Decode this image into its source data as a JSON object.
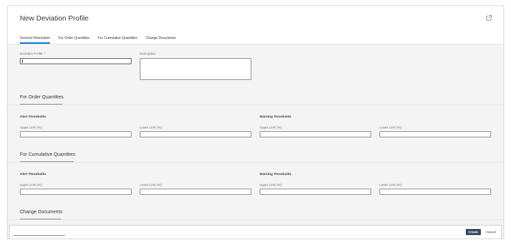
{
  "header": {
    "title": "New Deviation Profile",
    "tabs": [
      {
        "label": "General Information",
        "active": true
      },
      {
        "label": "For Order Quantities",
        "active": false
      },
      {
        "label": "For Cumulative Quantities",
        "active": false
      },
      {
        "label": "Change Documents",
        "active": false
      }
    ]
  },
  "general": {
    "profile_label": "Deviation Profile *",
    "description_label": "Description"
  },
  "order_section": {
    "title": "For Order Quantities",
    "alert_title": "Alert Thresholds",
    "warning_title": "Warning Thresholds",
    "upper_label": "Upper Limit (%):",
    "lower_label": "Lower Limit (%):"
  },
  "cumulative_section": {
    "title": "For Cumulative Quantities",
    "alert_title": "Alert Thresholds",
    "warning_title": "Warning Thresholds",
    "upper_label": "Upper Limit (%):",
    "lower_label": "Lower Limit (%):"
  },
  "change_section": {
    "title": "Change Documents"
  },
  "footer": {
    "create_label": "Create",
    "cancel_label": "Cancel"
  },
  "colors": {
    "accent": "#0a6ed1",
    "emphasized_button": "#354a5f"
  }
}
